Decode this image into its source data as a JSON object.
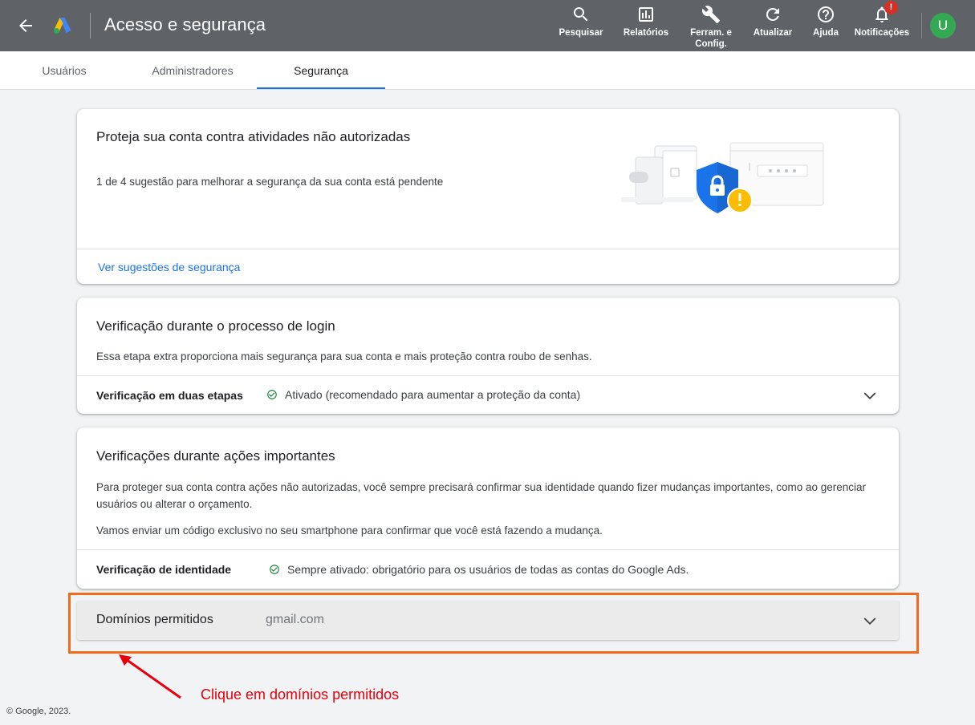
{
  "header": {
    "title": "Acesso e segurança",
    "tools": [
      {
        "label": "Pesquisar",
        "icon": "search-icon"
      },
      {
        "label": "Relatórios",
        "icon": "reports-icon"
      },
      {
        "label": "Ferram. e",
        "label2": "Config.",
        "icon": "wrench-icon"
      },
      {
        "label": "Atualizar",
        "icon": "refresh-icon"
      },
      {
        "label": "Ajuda",
        "icon": "help-icon"
      },
      {
        "label": "Notificações",
        "icon": "bell-icon",
        "badge": "!"
      }
    ],
    "avatar": "U"
  },
  "tabs": [
    {
      "label": "Usuários",
      "active": false
    },
    {
      "label": "Administradores",
      "active": false
    },
    {
      "label": "Segurança",
      "active": true
    }
  ],
  "card_protect": {
    "title": "Proteja sua conta contra atividades não autorizadas",
    "subtitle": "1 de 4 sugestão para melhorar a segurança da sua conta está pendente",
    "link": "Ver sugestões de segurança"
  },
  "card_login": {
    "title": "Verificação durante o processo de login",
    "text": "Essa etapa extra proporciona mais segurança para sua conta e mais proteção contra roubo de senhas.",
    "row_label": "Verificação em duas etapas",
    "row_status": "Ativado (recomendado para aumentar a proteção da conta)"
  },
  "card_actions": {
    "title": "Verificações durante ações importantes",
    "text1": "Para proteger sua conta contra ações não autorizadas, você sempre precisará confirmar sua identidade quando fizer mudanças importantes, como ao gerenciar usuários ou alterar o orçamento.",
    "text2": "Vamos enviar um código exclusivo no seu smartphone para confirmar que você está fazendo a mudança.",
    "row_label": "Verificação de identidade",
    "row_status": "Sempre ativado: obrigatório para os usuários de todas as contas do Google Ads."
  },
  "domains": {
    "label": "Domínios permitidos",
    "value": "gmail.com"
  },
  "annotation": "Clique em domínios permitidos",
  "footer": "© Google, 2023.",
  "colors": {
    "header_bg": "#5f6368",
    "accent": "#1a73e8",
    "success": "#188038",
    "highlight": "#f26a1b",
    "annotation": "#e8000c"
  }
}
